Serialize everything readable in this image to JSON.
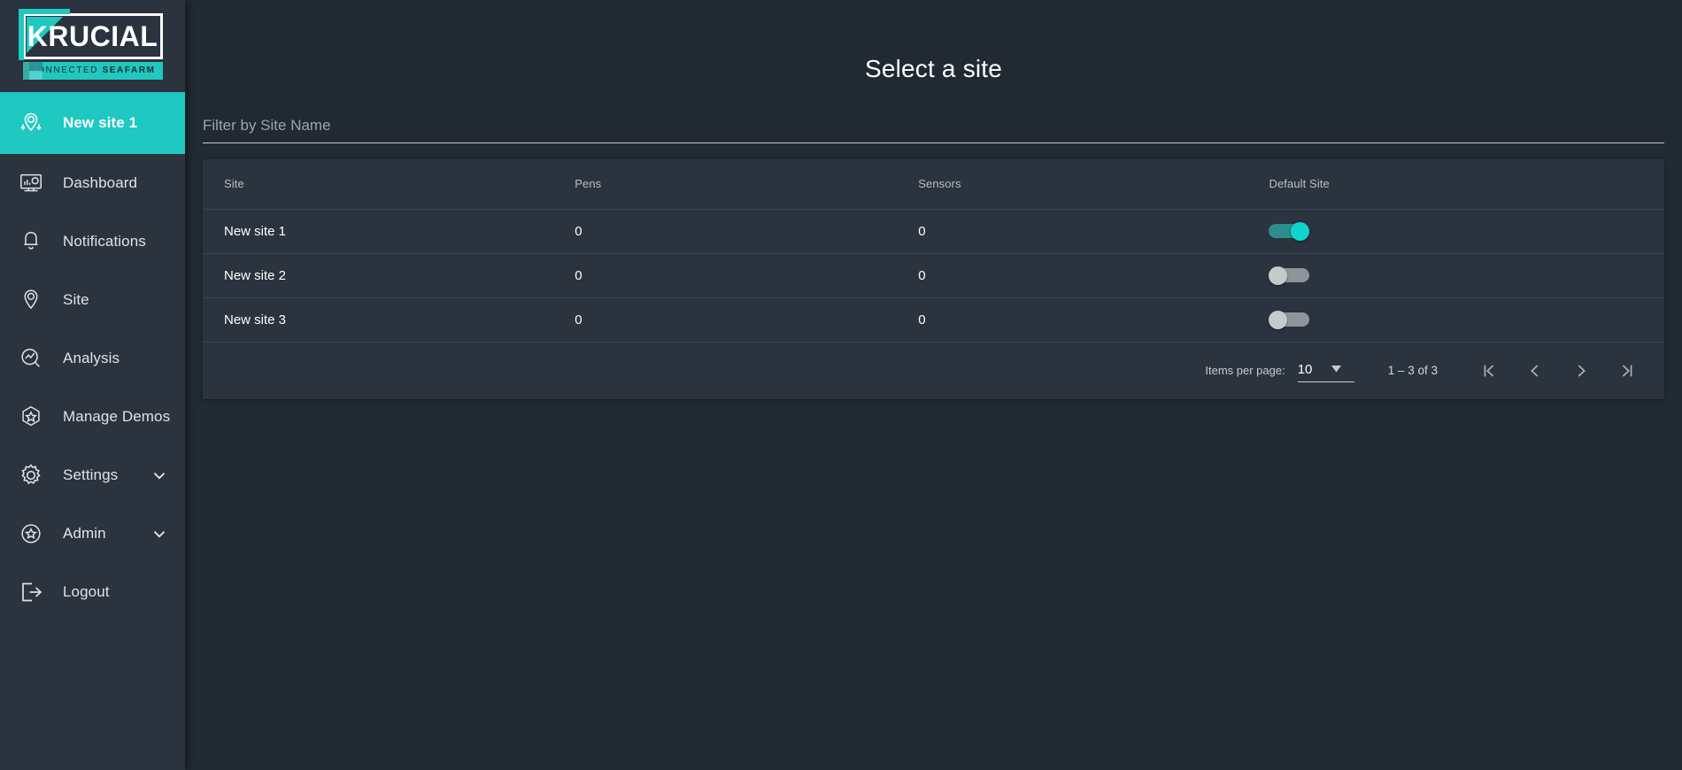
{
  "brand": {
    "word": "KRUCIAL",
    "tagline_light": "CONNECTED ",
    "tagline_bold": "SEAFARM",
    "accent_color": "#1fc8c0"
  },
  "sidebar": {
    "items": [
      {
        "label": "New site 1",
        "icon": "map-pin-arrows-icon",
        "active": true,
        "expandable": false
      },
      {
        "label": "Dashboard",
        "icon": "dashboard-icon",
        "active": false,
        "expandable": false
      },
      {
        "label": "Notifications",
        "icon": "bell-icon",
        "active": false,
        "expandable": false
      },
      {
        "label": "Site",
        "icon": "map-pin-icon",
        "active": false,
        "expandable": false
      },
      {
        "label": "Analysis",
        "icon": "analysis-icon",
        "active": false,
        "expandable": false
      },
      {
        "label": "Manage Demos",
        "icon": "hexagon-star-icon",
        "active": false,
        "expandable": false
      },
      {
        "label": "Settings",
        "icon": "gear-icon",
        "active": false,
        "expandable": true
      },
      {
        "label": "Admin",
        "icon": "circle-star-icon",
        "active": false,
        "expandable": true
      },
      {
        "label": "Logout",
        "icon": "logout-icon",
        "active": false,
        "expandable": false
      }
    ]
  },
  "main": {
    "title": "Select a site",
    "filter": {
      "placeholder": "Filter by Site Name",
      "value": ""
    },
    "table": {
      "columns": [
        "Site",
        "Pens",
        "Sensors",
        "Default Site"
      ],
      "rows": [
        {
          "site": "New site 1",
          "pens": "0",
          "sensors": "0",
          "default_site": true
        },
        {
          "site": "New site 2",
          "pens": "0",
          "sensors": "0",
          "default_site": false
        },
        {
          "site": "New site 3",
          "pens": "0",
          "sensors": "0",
          "default_site": false
        }
      ]
    },
    "paginator": {
      "items_per_page_label": "Items per page:",
      "items_per_page_value": "10",
      "range_label": "1 – 3 of 3",
      "buttons": [
        "first-page",
        "previous-page",
        "next-page",
        "last-page"
      ]
    }
  }
}
